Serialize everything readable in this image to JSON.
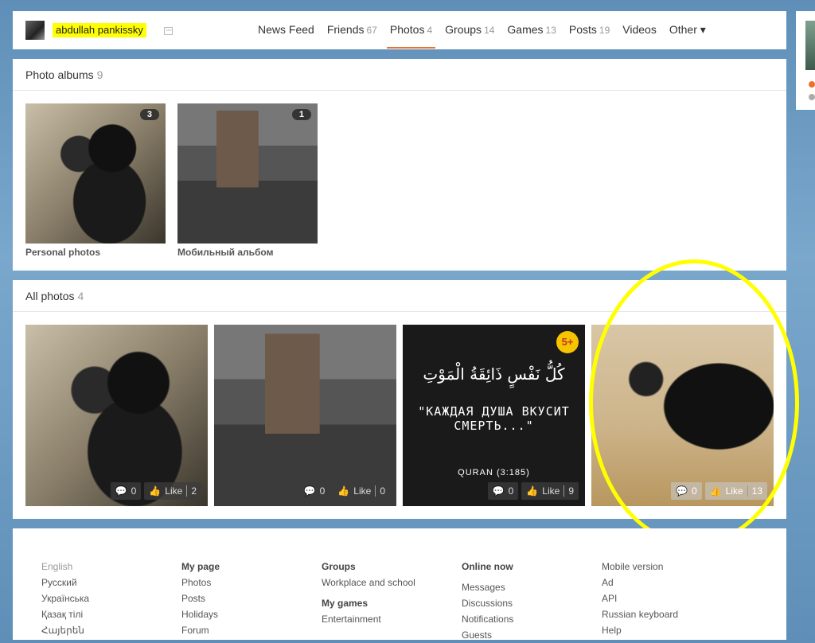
{
  "header": {
    "username": "abdullah pankissky",
    "nav": [
      {
        "label": "News Feed",
        "count": ""
      },
      {
        "label": "Friends",
        "count": "67"
      },
      {
        "label": "Photos",
        "count": "4"
      },
      {
        "label": "Groups",
        "count": "14"
      },
      {
        "label": "Games",
        "count": "13"
      },
      {
        "label": "Posts",
        "count": "19"
      },
      {
        "label": "Videos",
        "count": ""
      },
      {
        "label": "Other ▾",
        "count": ""
      }
    ]
  },
  "albums": {
    "title": "Photo albums",
    "count": "9",
    "items": [
      {
        "label": "Personal photos",
        "badge": "3"
      },
      {
        "label": "Мобильный альбом",
        "badge": "1"
      }
    ]
  },
  "all_photos": {
    "title": "All photos",
    "count": "4",
    "items": [
      {
        "comments": "0",
        "like_label": "Like",
        "likes": "2"
      },
      {
        "comments": "0",
        "like_label": "Like",
        "likes": "0"
      },
      {
        "comments": "0",
        "like_label": "Like",
        "likes": "9",
        "age_badge": "5+",
        "arabic": "كُلُّ نَفْسٍ ذَائِقَةُ الْمَوْتِ",
        "quote": "\"Каждая душа вкусит смерть...\"",
        "source": "Quran (3:185)"
      },
      {
        "comments": "0",
        "like_label": "Like",
        "likes": "13"
      }
    ]
  },
  "footer": {
    "languages": [
      "English",
      "Русский",
      "Українська",
      "Қазақ тілі",
      "Հայերեն"
    ],
    "my_page": {
      "title": "My page",
      "items": [
        "Photos",
        "Posts",
        "Holidays",
        "Forum"
      ]
    },
    "groups": {
      "title": "Groups",
      "items": [
        "Workplace and school"
      ]
    },
    "my_games": {
      "title": "My games",
      "items": [
        "Entertainment"
      ]
    },
    "online": {
      "title": "Online now",
      "items": [
        "Messages",
        "Discussions",
        "Notifications",
        "Guests"
      ]
    },
    "misc": [
      "Mobile version",
      "Ad",
      "API",
      "Russian keyboard",
      "Help"
    ]
  },
  "colors": {
    "accent": "#eb722e",
    "highlight": "#ffff00"
  }
}
